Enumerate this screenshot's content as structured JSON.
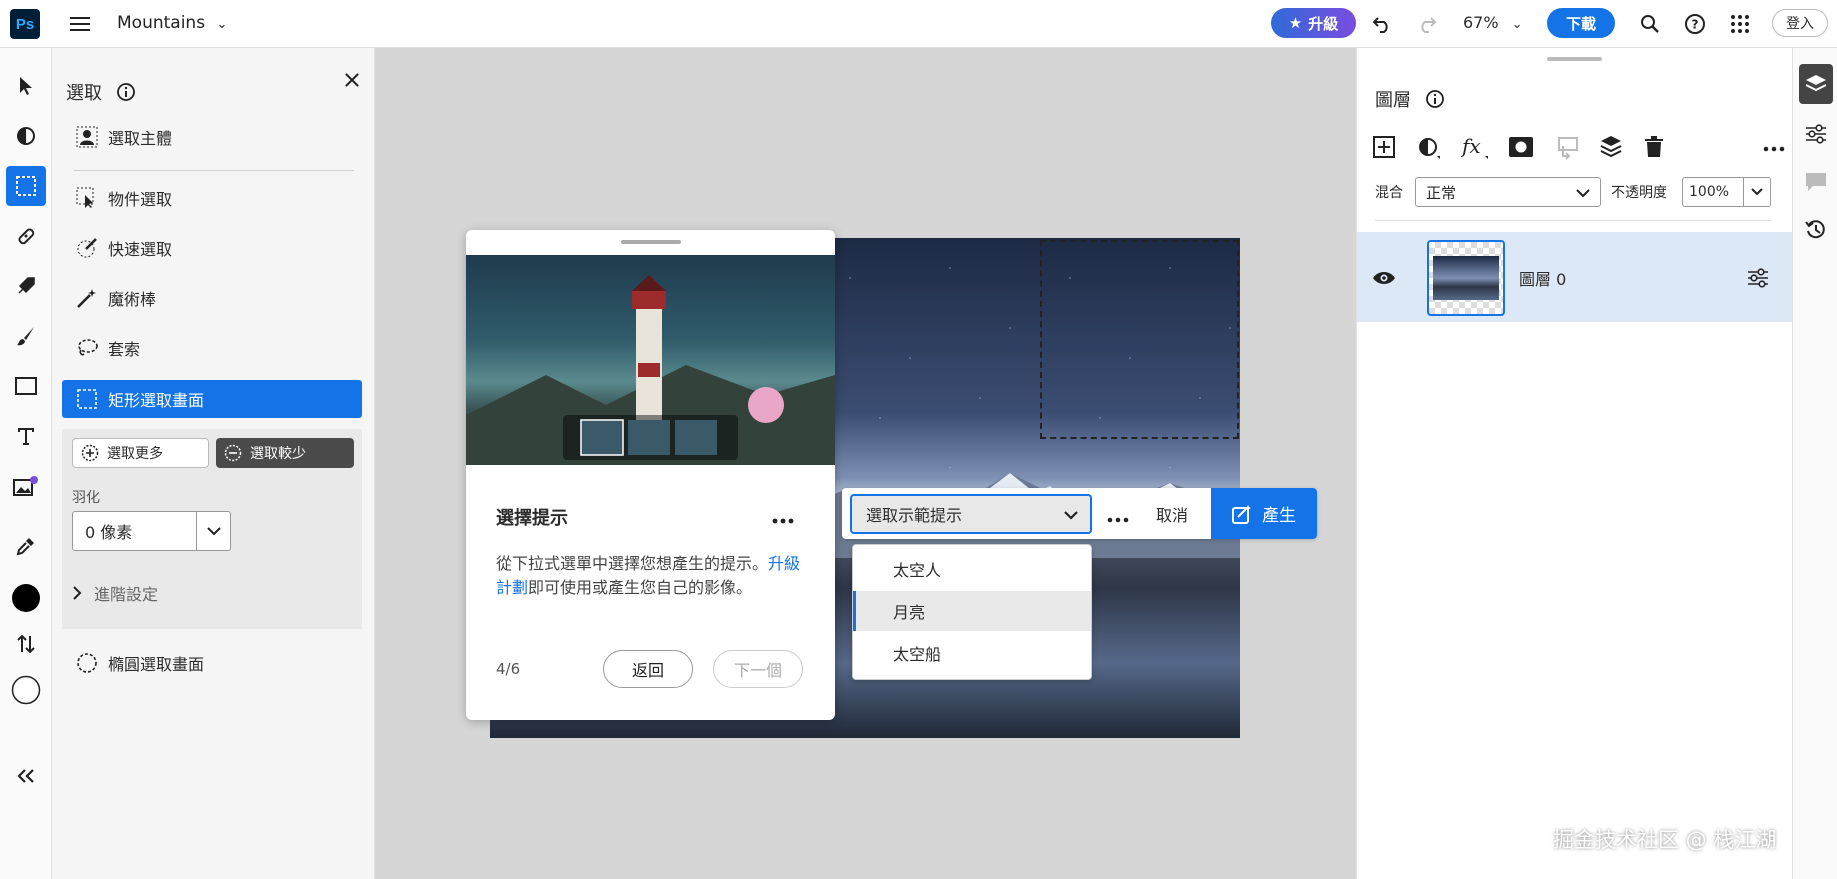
{
  "app": {
    "logo": "Ps",
    "doc_title": "Mountains",
    "upgrade_label": "升級",
    "zoom": "67%",
    "download_label": "下載",
    "signin_label": "登入"
  },
  "selection_panel": {
    "title": "選取",
    "items": [
      {
        "label": "選取主體",
        "icon": "select-subject-icon"
      },
      {
        "label": "物件選取",
        "icon": "object-select-icon"
      },
      {
        "label": "快速選取",
        "icon": "quick-select-icon"
      },
      {
        "label": "魔術棒",
        "icon": "magic-wand-icon"
      },
      {
        "label": "套索",
        "icon": "lasso-icon"
      },
      {
        "label": "矩形選取畫面",
        "icon": "rect-marquee-icon"
      },
      {
        "label": "橢圓選取畫面",
        "icon": "ellipse-marquee-icon"
      }
    ],
    "add_label": "選取更多",
    "subtract_label": "選取較少",
    "feather_label": "羽化",
    "feather_value": "0 像素",
    "advanced_label": "進階設定"
  },
  "tip_card": {
    "title": "選擇提示",
    "body_pre": "從下拉式選單中選擇您想產生的提示。",
    "body_link": "升級計劃",
    "body_post": "即可使用或產生您自己的影像。",
    "step": "4/6",
    "back_label": "返回",
    "next_label": "下一個"
  },
  "prompt_bar": {
    "select_value": "選取示範提示",
    "cancel_label": "取消",
    "generate_label": "產生",
    "options": [
      "太空人",
      "月亮",
      "太空船"
    ],
    "selected_option": "月亮"
  },
  "layers_panel": {
    "title": "圖層",
    "blend_label": "混合",
    "blend_value": "正常",
    "opacity_label": "不透明度",
    "opacity_value": "100%",
    "layer_name": "圖層 0"
  },
  "watermark": "掘金技术社区 @ 栈江湖",
  "colors": {
    "accent": "#1473e6",
    "canvas_bg": "#d6d6d6"
  }
}
